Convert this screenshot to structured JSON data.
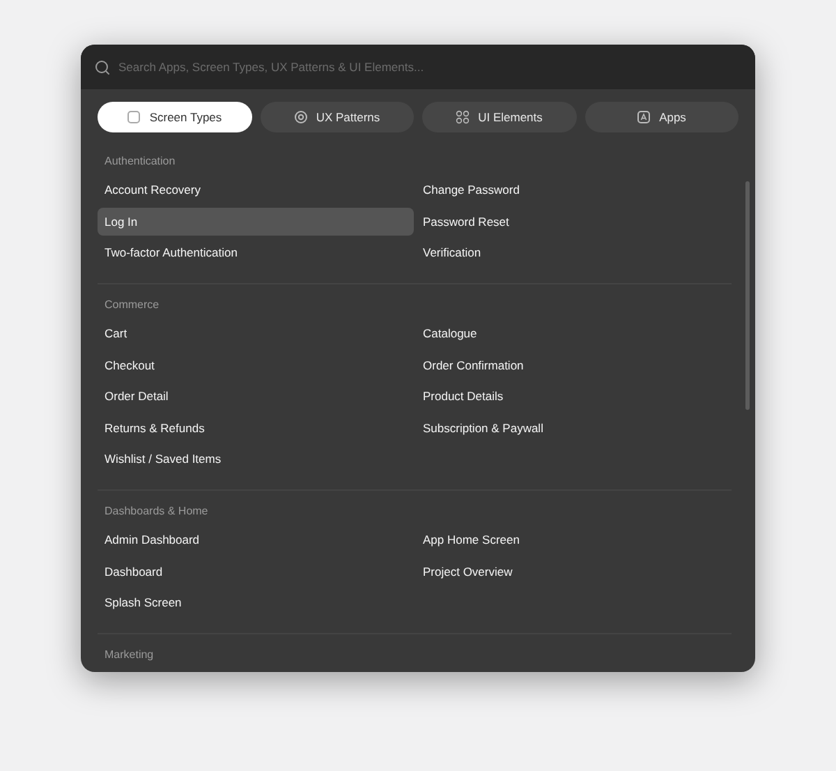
{
  "search": {
    "placeholder": "Search Apps, Screen Types, UX Patterns & UI Elements..."
  },
  "tabs": [
    {
      "label": "Screen Types",
      "kind": "screen",
      "selected": true
    },
    {
      "label": "UX Patterns",
      "kind": "pattern",
      "selected": false
    },
    {
      "label": "UI Elements",
      "kind": "element",
      "selected": false
    },
    {
      "label": "Apps",
      "kind": "app",
      "selected": false
    }
  ],
  "sections": [
    {
      "title": "Authentication",
      "items": [
        {
          "label": "Account Recovery",
          "selected": false
        },
        {
          "label": "Change Password",
          "selected": false
        },
        {
          "label": "Log In",
          "selected": true
        },
        {
          "label": "Password Reset",
          "selected": false
        },
        {
          "label": "Two-factor Authentication",
          "selected": false
        },
        {
          "label": "Verification",
          "selected": false
        }
      ]
    },
    {
      "title": "Commerce",
      "items": [
        {
          "label": "Cart",
          "selected": false
        },
        {
          "label": "Catalogue",
          "selected": false
        },
        {
          "label": "Checkout",
          "selected": false
        },
        {
          "label": "Order Confirmation",
          "selected": false
        },
        {
          "label": "Order Detail",
          "selected": false
        },
        {
          "label": "Product Details",
          "selected": false
        },
        {
          "label": "Returns & Refunds",
          "selected": false
        },
        {
          "label": "Subscription & Paywall",
          "selected": false
        },
        {
          "label": "Wishlist / Saved Items",
          "selected": false
        }
      ]
    },
    {
      "title": "Dashboards & Home",
      "items": [
        {
          "label": "Admin Dashboard",
          "selected": false
        },
        {
          "label": "App Home Screen",
          "selected": false
        },
        {
          "label": "Dashboard",
          "selected": false
        },
        {
          "label": "Project Overview",
          "selected": false
        },
        {
          "label": "Splash Screen",
          "selected": false
        }
      ]
    },
    {
      "title": "Marketing"
    }
  ]
}
